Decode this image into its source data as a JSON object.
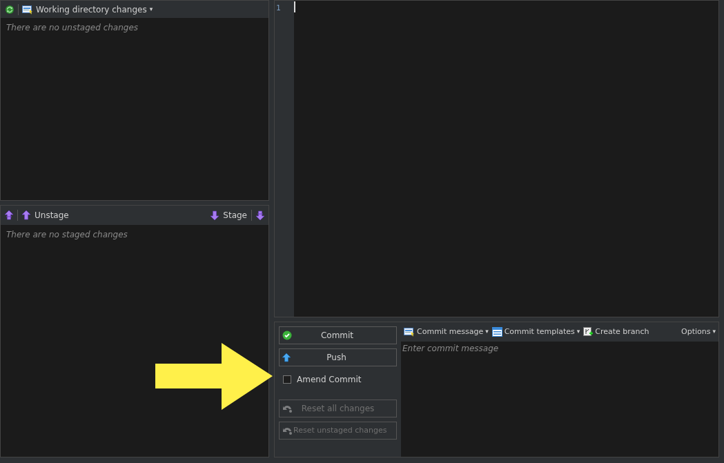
{
  "unstaged": {
    "toolbar_title": "Working directory changes",
    "dropdown": "▾",
    "empty_text": "There are no unstaged changes"
  },
  "staged": {
    "unstage_label": "Unstage",
    "stage_label": "Stage",
    "empty_text": "There are no staged changes"
  },
  "editor": {
    "line_numbers": [
      "1"
    ]
  },
  "commit_panel": {
    "buttons": [
      {
        "label": "Commit",
        "kind": "commit",
        "disabled": false
      },
      {
        "label": "Push",
        "kind": "push",
        "disabled": false
      },
      {
        "label": "Amend Commit",
        "kind": "checkbox",
        "checked": false
      },
      {
        "label": "Reset all changes",
        "kind": "reset",
        "disabled": true
      },
      {
        "label": "Reset unstaged changes",
        "kind": "reset-left",
        "disabled": true
      }
    ],
    "toolbar": [
      {
        "label": "Commit message",
        "dropdown": "▾"
      },
      {
        "label": "Commit templates",
        "dropdown": "▾"
      },
      {
        "label": "Create branch"
      }
    ],
    "options": {
      "label": "Options",
      "dropdown": "▾"
    },
    "placeholder": "Enter commit message"
  }
}
